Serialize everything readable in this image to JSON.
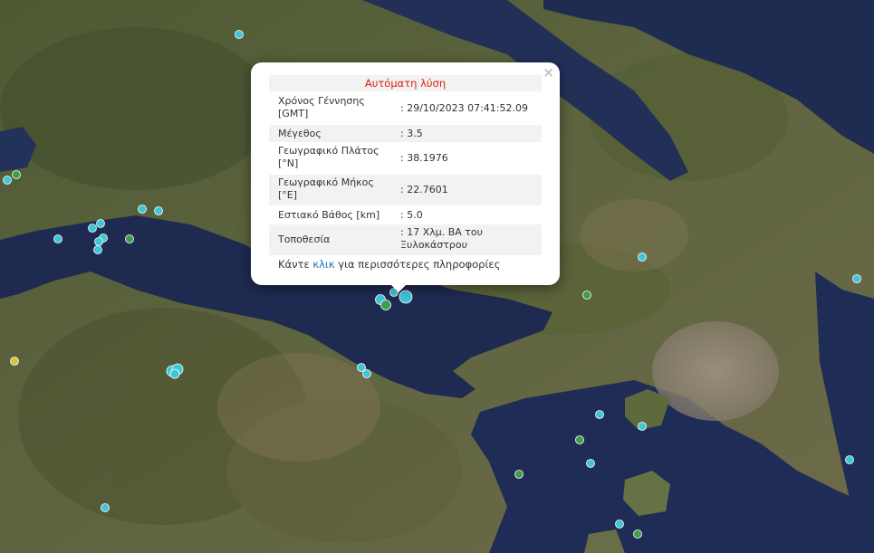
{
  "popup": {
    "title": "Αυτόματη λύση",
    "close_label": "×",
    "rows": [
      {
        "key": "Χρόνος Γέννησης [GMT]",
        "value": ": 29/10/2023 07:41:52.09"
      },
      {
        "key": "Μέγεθος",
        "value": ": 3.5"
      },
      {
        "key": "Γεωγραφικό Πλάτος [°N]",
        "value": ": 38.1976"
      },
      {
        "key": "Γεωγραφικό Μήκος [°E]",
        "value": ": 22.7601"
      },
      {
        "key": "Εστιακό Βάθος [km]",
        "value": ": 5.0"
      },
      {
        "key": "Τοποθεσία",
        "value": ": 17 Χλμ. ΒΑ του Ξυλοκάστρου"
      }
    ],
    "more_prefix": "Κάντε",
    "more_link": "κλικ",
    "more_suffix": "για περισσότερες πληροφορίες"
  },
  "map": {
    "basemap": "satellite imagery",
    "colors": {
      "sea": "#1f2c52",
      "land": "#5a6338",
      "marker_cyan": "#3fc6d8",
      "marker_green": "#3e9e4d",
      "marker_yellow": "#d8c43c"
    }
  }
}
